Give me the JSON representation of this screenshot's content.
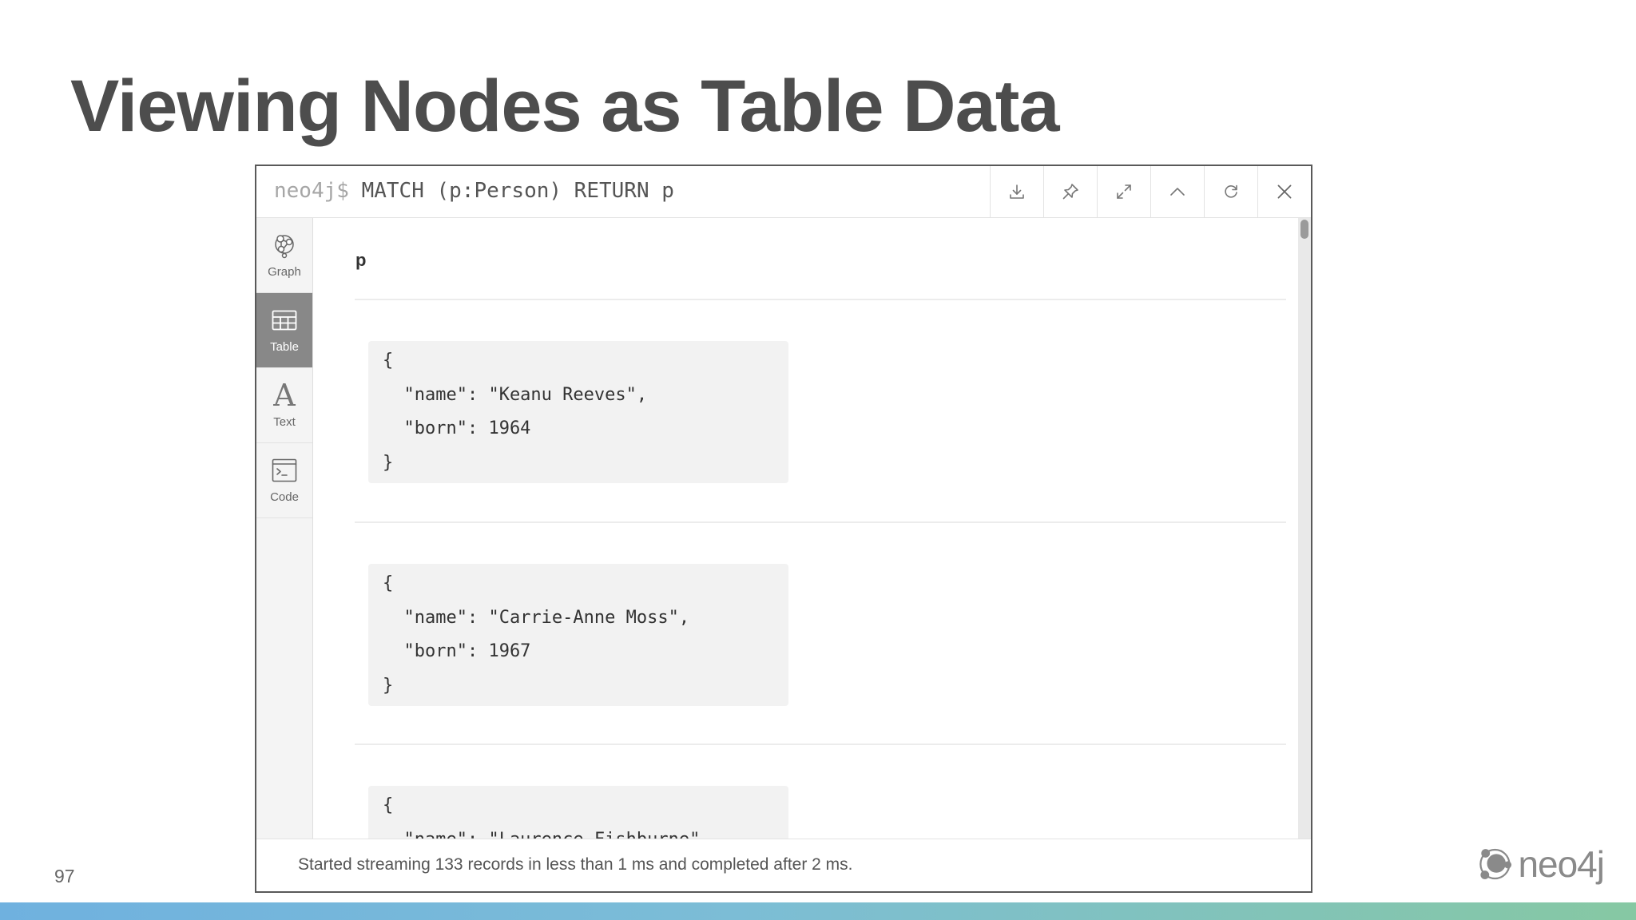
{
  "slide": {
    "title": "Viewing Nodes as Table Data",
    "page_number": "97",
    "logo_text": "neo4j"
  },
  "query_bar": {
    "prompt": "neo4j$",
    "query": "MATCH (p:Person) RETURN p"
  },
  "toolbar": {
    "actions": [
      {
        "name": "download-icon"
      },
      {
        "name": "pin-icon"
      },
      {
        "name": "expand-icon"
      },
      {
        "name": "collapse-icon"
      },
      {
        "name": "rerun-icon"
      },
      {
        "name": "close-icon"
      }
    ]
  },
  "sidebar": {
    "items": [
      {
        "label": "Graph",
        "icon": "graph-icon",
        "active": false
      },
      {
        "label": "Table",
        "icon": "table-icon",
        "active": true
      },
      {
        "label": "Text",
        "icon": "text-icon",
        "active": false
      },
      {
        "label": "Code",
        "icon": "code-icon",
        "active": false
      }
    ]
  },
  "table": {
    "column_header": "p",
    "records": [
      {
        "open": "{",
        "line1": "  \"name\": \"Keanu Reeves\",",
        "line2": "  \"born\": 1964",
        "close": "}"
      },
      {
        "open": "{",
        "line1": "  \"name\": \"Carrie-Anne Moss\",",
        "line2": "  \"born\": 1967",
        "close": "}"
      },
      {
        "open": "{",
        "line1": "  \"name\": \"Laurence Fishburne\","
      }
    ]
  },
  "status_bar": {
    "text": "Started streaming 133 records in less than 1 ms and completed after 2 ms."
  },
  "colors": {
    "title": "#4d4d4d",
    "sidebar_active": "#888888",
    "record_bg": "#f2f2f2",
    "band_start": "#6fb1df",
    "band_end": "#86c8a3"
  }
}
